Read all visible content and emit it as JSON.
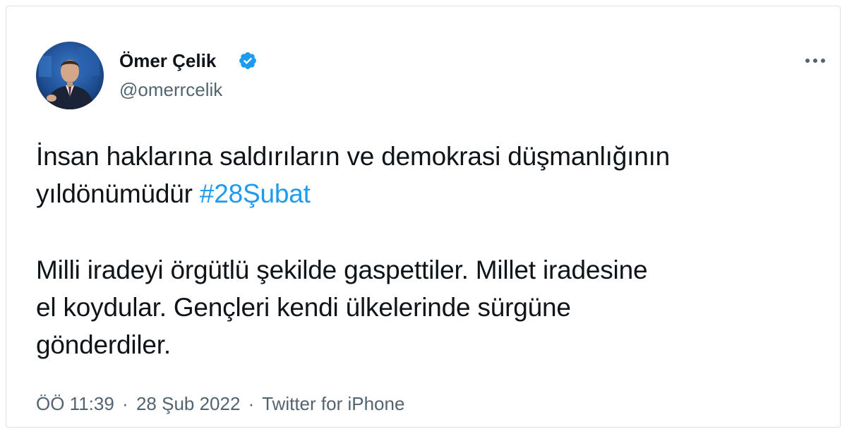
{
  "author": {
    "display_name": "Ömer Çelik",
    "handle": "@omerrcelik",
    "verified_icon": "verified-badge-icon",
    "avatar": "profile-photo"
  },
  "menu": {
    "icon": "more-options-icon"
  },
  "tweet": {
    "line1": "İnsan haklarına saldırıların ve demokrasi düşmanlığının",
    "line2_text": "yıldönümüdür ",
    "hashtag": "#28Şubat",
    "line3": "Milli iradeyi örgütlü şekilde gaspettiler. Millet iradesine",
    "line4": "el koydular. Gençleri kendi ülkelerinde sürgüne",
    "line5": "gönderdiler."
  },
  "meta": {
    "time": "ÖÖ 11:39",
    "separator": "·",
    "date": "28 Şub 2022",
    "source": "Twitter for iPhone"
  },
  "colors": {
    "text": "#0f1419",
    "secondary": "#536471",
    "link": "#1d9bf0",
    "verified": "#1d9bf0",
    "border": "#dcdfe3"
  }
}
